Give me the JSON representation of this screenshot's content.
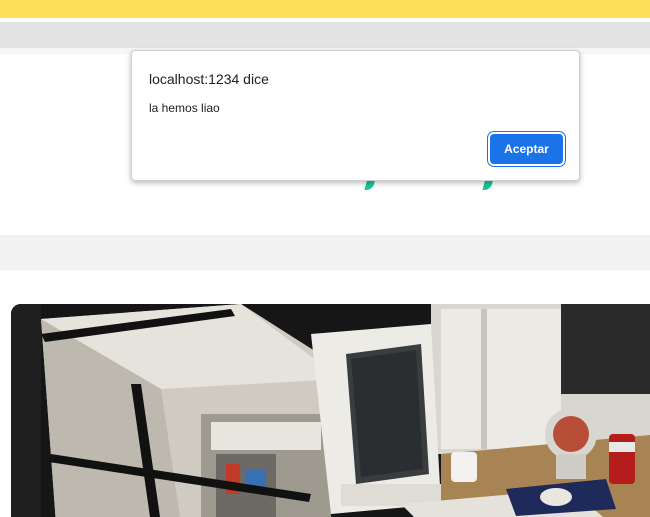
{
  "dialog": {
    "title": "localhost:1234 dice",
    "message": "la hemos liao",
    "button_label": "Aceptar"
  },
  "colors": {
    "top_strip": "#ffdf5c",
    "grey_bar": "#e3e3e3",
    "accent_teal": "#1cc39a",
    "button_blue": "#1a73e8"
  }
}
